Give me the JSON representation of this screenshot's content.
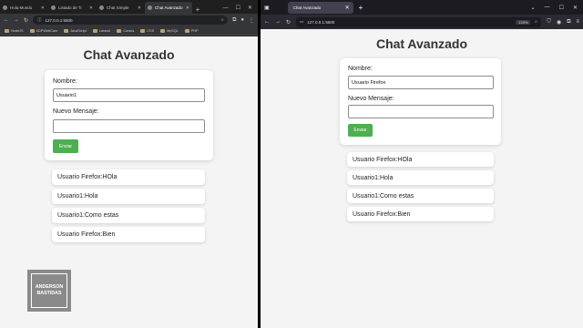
{
  "left_browser": {
    "tabs": [
      {
        "label": "Hola Mundo"
      },
      {
        "label": "Listado de Ti"
      },
      {
        "label": "Chat Simple"
      },
      {
        "label": "Chat Avanzado"
      }
    ],
    "active_tab": 3,
    "url": "127.0.0.1:5500",
    "bookmarks": [
      "NodeJS",
      "XDPWebCam",
      "JavaScript",
      "Laravel",
      "Cursos",
      "CSS",
      "MySQL",
      "PHP"
    ]
  },
  "right_browser": {
    "tab_label": "Chat Avanzado",
    "url": "127.0.0.1:5500",
    "zoom_label": "133%"
  },
  "left_app": {
    "title": "Chat Avanzado",
    "name_label": "Nombre:",
    "name_value": "Usuario1",
    "message_label": "Nuevo Mensaje:",
    "message_value": "",
    "send_button": "Enviar",
    "messages": [
      "Usuario Firefox:HOla",
      "Usuario1:Hola",
      "Usuario1:Como estas",
      "Usuario Firefox:Bien"
    ]
  },
  "right_app": {
    "title": "Chat Avanzado",
    "name_label": "Nombre:",
    "name_value": "Usuario Firefox",
    "message_label": "Nuevo Mensaje:",
    "message_value": "",
    "send_button": "Enviar",
    "messages": [
      "Usuario Firefox:HOla",
      "Usuario1:Hola",
      "Usuario1:Como estas",
      "Usuario Firefox:Bien"
    ]
  },
  "watermark": {
    "line1": "ANDERSON",
    "line2": "BASTIDAS"
  },
  "colors": {
    "send_button": "#4caf50",
    "page_background": "#f4f4f4"
  }
}
